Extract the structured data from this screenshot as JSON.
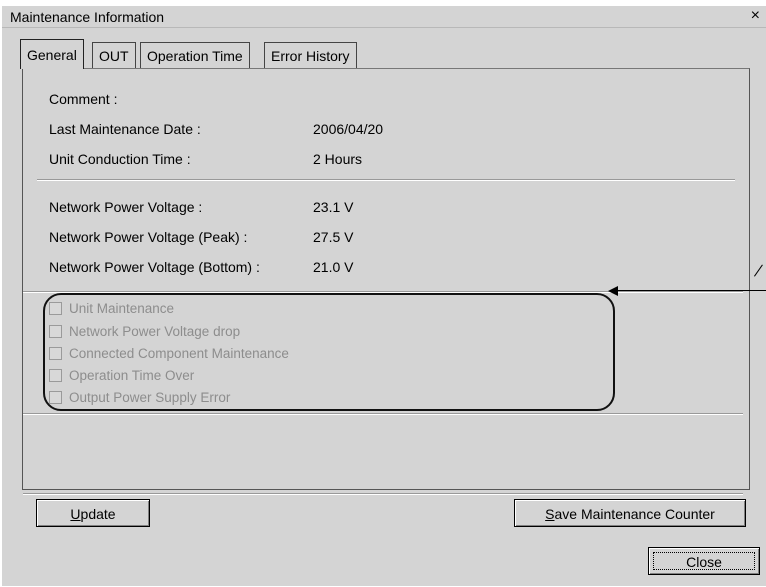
{
  "window": {
    "title": "Maintenance Information",
    "close_glyph": "×"
  },
  "tabs": [
    {
      "label": "General",
      "active": true
    },
    {
      "label": "OUT",
      "active": false
    },
    {
      "label": "Operation Time",
      "active": false
    },
    {
      "label": "Error History",
      "active": false
    }
  ],
  "general": {
    "comment_label": "Comment :",
    "comment_value": "",
    "last_maintenance_label": "Last Maintenance Date :",
    "last_maintenance_value": "2006/04/20",
    "conduction_label": "Unit Conduction Time :",
    "conduction_value": "2 Hours",
    "npv_label": "Network Power Voltage :",
    "npv_value": "23.1 V",
    "npv_peak_label": "Network Power Voltage (Peak) :",
    "npv_peak_value": "27.5 V",
    "npv_bottom_label": "Network Power Voltage (Bottom) :",
    "npv_bottom_value": "21.0 V"
  },
  "checkboxes": [
    {
      "label": "Unit Maintenance",
      "checked": false,
      "enabled": false
    },
    {
      "label": "Network Power Voltage drop",
      "checked": false,
      "enabled": false
    },
    {
      "label": "Connected Component Maintenance",
      "checked": false,
      "enabled": false
    },
    {
      "label": "Operation Time Over",
      "checked": false,
      "enabled": false
    },
    {
      "label": "Output Power Supply Error",
      "checked": false,
      "enabled": false
    }
  ],
  "buttons": {
    "update": {
      "accel": "U",
      "rest": "pdate"
    },
    "save": {
      "accel": "S",
      "rest": "ave Maintenance Counter"
    },
    "close": "Close"
  }
}
